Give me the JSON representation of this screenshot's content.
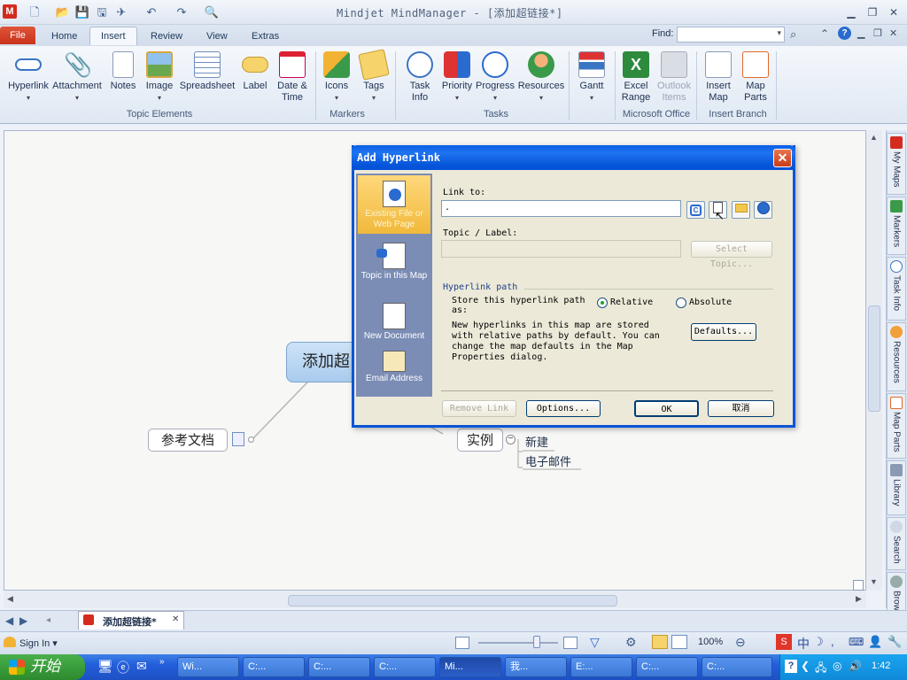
{
  "app": {
    "logo": "M",
    "title": "Mindjet MindManager - [添加超链接*]"
  },
  "ribbon_tabs": [
    "File",
    "Home",
    "Insert",
    "Review",
    "View",
    "Extras"
  ],
  "find": {
    "label": "Find:",
    "value": ""
  },
  "ribbon": {
    "buttons": [
      {
        "label": "Hyperlink",
        "icon": "hyperlink-icon"
      },
      {
        "label": "Attachment",
        "icon": "paperclip-icon"
      },
      {
        "label": "Notes",
        "icon": "notes-icon"
      },
      {
        "label": "Image",
        "icon": "image-icon"
      },
      {
        "label": "Spreadsheet",
        "icon": "spreadsheet-icon"
      },
      {
        "label": "Label",
        "icon": "label-icon"
      },
      {
        "label": "Date &",
        "label2": "Time",
        "icon": "calendar-icon"
      },
      {
        "label": "Icons",
        "icon": "icons-icon"
      },
      {
        "label": "Tags",
        "icon": "tags-icon"
      },
      {
        "label": "Task",
        "label2": "Info",
        "icon": "task-info-icon"
      },
      {
        "label": "Priority",
        "icon": "priority-icon"
      },
      {
        "label": "Progress",
        "icon": "progress-icon"
      },
      {
        "label": "Resources",
        "icon": "resources-icon"
      },
      {
        "label": "Gantt",
        "icon": "gantt-icon"
      },
      {
        "label": "Excel",
        "label2": "Range",
        "icon": "excel-icon"
      },
      {
        "label": "Outlook",
        "label2": "Items",
        "icon": "outlook-icon"
      },
      {
        "label": "Insert",
        "label2": "Map",
        "icon": "insert-map-icon"
      },
      {
        "label": "Map",
        "label2": "Parts",
        "icon": "map-parts-icon"
      }
    ],
    "groups": [
      "Topic Elements",
      "Markers",
      "Tasks",
      "Microsoft Office",
      "Insert Branch"
    ]
  },
  "mindmap": {
    "central": "添加超",
    "left_topic": "参考文档",
    "right_topic": "实例",
    "subtopics": [
      "新建",
      "电子邮件"
    ]
  },
  "sidebar_tabs": [
    "My Maps",
    "Markers",
    "Task Info",
    "Resources",
    "Map Parts",
    "Library",
    "Search",
    "Browser"
  ],
  "dialog": {
    "title": "Add Hyperlink",
    "close": "✕",
    "nav": [
      {
        "label": "Existing File or Web Page",
        "icon": "web-page-icon"
      },
      {
        "label": "Topic in this Map",
        "icon": "topic-icon"
      },
      {
        "label": "New Document",
        "icon": "new-document-icon"
      },
      {
        "label": "Email Address",
        "icon": "email-icon"
      }
    ],
    "link_to_label": "Link to:",
    "link_to_value": ".",
    "topic_label": "Topic / Label:",
    "topic_value": "",
    "select_topic": "Select Topic...",
    "path_heading": "Hyperlink path",
    "store_label": "Store this hyperlink path as:",
    "relative": "Relative",
    "absolute": "Absolute",
    "description": "New hyperlinks in this map are stored with relative paths by default. You can change the map defaults in the Map Properties dialog.",
    "defaults": "Defaults...",
    "remove_link": "Remove Link",
    "options": "Options...",
    "ok": "OK",
    "cancel": "取消"
  },
  "doc_tab": {
    "label": "添加超链接*",
    "close": "✕"
  },
  "statusbar": {
    "sign_in": "Sign In",
    "zoom": "100%"
  },
  "taskbar": {
    "start": "开始",
    "tasks": [
      "Wi...",
      "C:...",
      "C:...",
      "C:...",
      "Mi...",
      "我...",
      "E:...",
      "C:...",
      "C:..."
    ],
    "active_index": 4,
    "clock": "1:42"
  }
}
